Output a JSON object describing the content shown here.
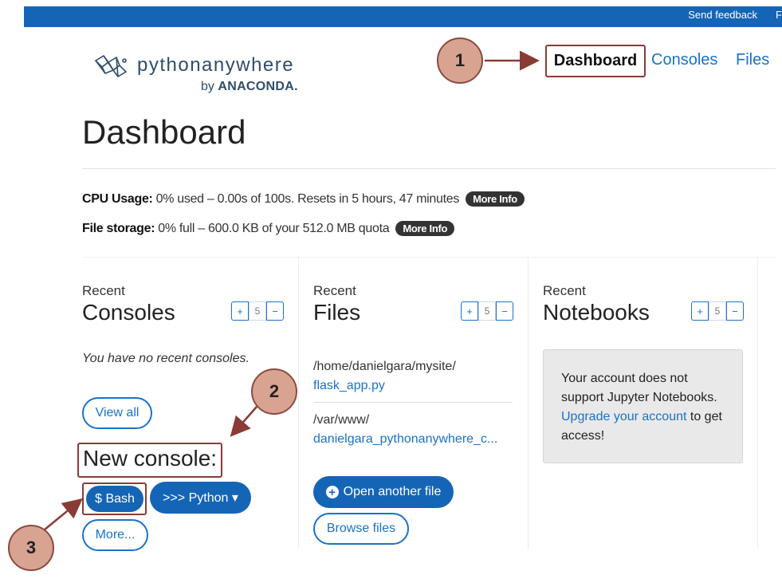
{
  "topbar": {
    "feedback": "Send feedback",
    "cutoff": "F"
  },
  "logo": {
    "brand": "pythonanywhere",
    "by": "by",
    "company": "ANACONDA."
  },
  "nav": {
    "dashboard": "Dashboard",
    "consoles": "Consoles",
    "files": "Files"
  },
  "callouts": [
    "1",
    "2",
    "3"
  ],
  "page_title": "Dashboard",
  "usage": {
    "cpu_label": "CPU Usage:",
    "cpu_text": "0% used – 0.00s of 100s. Resets in 5 hours, 47 minutes",
    "storage_label": "File storage:",
    "storage_text": "0% full – 600.0 KB of your 512.0 MB quota",
    "more_info": "More Info"
  },
  "pager": {
    "plus": "+",
    "count": "5",
    "minus": "−"
  },
  "consoles": {
    "recent": "Recent",
    "title": "Consoles",
    "empty": "You have no recent consoles.",
    "view_all": "View all",
    "new_console": "New console:",
    "bash": "$ Bash",
    "python": ">>> Python ▾",
    "more": "More..."
  },
  "files": {
    "recent": "Recent",
    "title": "Files",
    "items": [
      {
        "path": "/home/danielgara/mysite/",
        "name": "flask_app.py"
      },
      {
        "path": "/var/www/",
        "name": "danielgara_pythonanywhere_c..."
      }
    ],
    "open_another": "Open another file",
    "browse": "Browse files"
  },
  "notebooks": {
    "recent": "Recent",
    "title": "Notebooks",
    "notice_pre": "Your account does not support Jupyter Notebooks.",
    "notice_link": "Upgrade your account",
    "notice_post": "to get access!"
  },
  "colors": {
    "brand_blue": "#1565b7",
    "link_blue": "#1a72c9",
    "callout_fill": "#d9a392",
    "callout_border": "#8a3b36"
  }
}
